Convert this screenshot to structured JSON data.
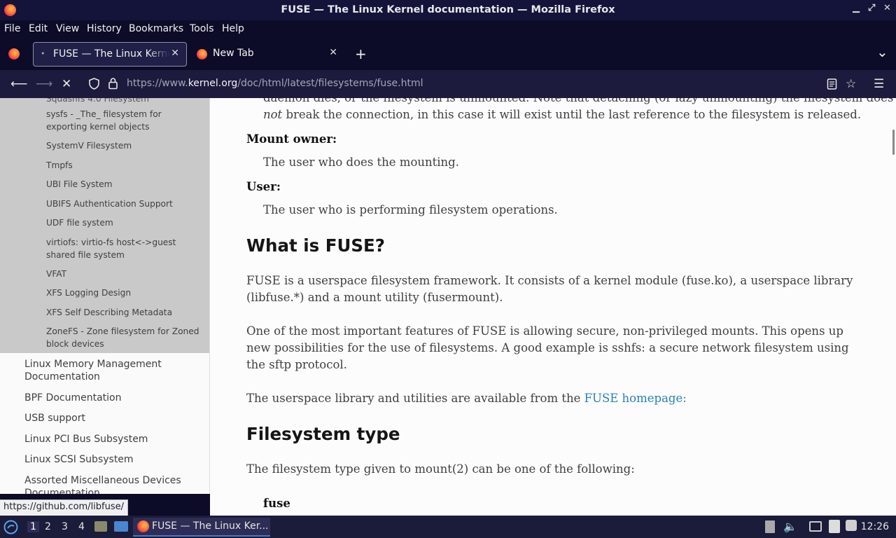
{
  "window": {
    "title": "FUSE — The Linux Kernel documentation — Mozilla Firefox",
    "min": "▁",
    "max": "⤢",
    "close": "✕"
  },
  "menu": [
    "File",
    "Edit",
    "View",
    "History",
    "Bookmarks",
    "Tools",
    "Help"
  ],
  "tabs": [
    {
      "label": "FUSE — The Linux Kernel documentation",
      "close": "✕"
    },
    {
      "label": "New Tab",
      "close": "✕"
    }
  ],
  "tabbar": {
    "new_tab": "+",
    "list": "⌄"
  },
  "nav": {
    "url_pre": "https://www.",
    "url_host": "kernel.org",
    "url_post": "/doc/html/latest/filesystems/fuse.html"
  },
  "sidebar": {
    "sub_items": [
      "sysfs - _The_ filesystem for exporting kernel objects",
      "SystemV Filesystem",
      "Tmpfs",
      "UBI File System",
      "UBIFS Authentication Support",
      "UDF file system",
      "virtiofs: virtio-fs host<->guest shared file system",
      "VFAT",
      "XFS Logging Design",
      "XFS Self Describing Metadata",
      "ZoneFS - Zone filesystem for Zoned block devices"
    ],
    "top_items": [
      "Linux Memory Management Documentation",
      "BPF Documentation",
      "USB support",
      "Linux PCI Bus Subsystem",
      "Linux SCSI Subsystem",
      "Assorted Miscellaneous Devices Documentation"
    ]
  },
  "content": {
    "frag1": "daemon dies, or the filesystem is unmounted. Note that detaching (or lazy unmounting) the filesystem does",
    "frag2_em": "not",
    "frag2": " break the connection, in this case it will exist until the last reference to the filesystem is released.",
    "dt1": "Mount owner:",
    "dd1": "The user who does the mounting.",
    "dt2": "User:",
    "dd2": "The user who is performing filesystem operations.",
    "h1": "What is FUSE?",
    "p1": "FUSE is a userspace filesystem framework. It consists of a kernel module (fuse.ko), a userspace library (libfuse.*) and a mount utility (fusermount).",
    "p2": "One of the most important features of FUSE is allowing secure, non-privileged mounts. This opens up new possibilities for the use of filesystems. A good example is sshfs: a secure network filesystem using the sftp protocol.",
    "p3": "The userspace library and utilities are available from the ",
    "p3_link": "FUSE homepage:",
    "h2": "Filesystem type",
    "p4": "The filesystem type given to mount(2) can be one of the following:",
    "dt3": "fuse"
  },
  "status_link": "https://github.com/libfuse/",
  "taskbar": {
    "workspaces": [
      "1",
      "2",
      "3",
      "4"
    ],
    "app": "FUSE — The Linux Ker...",
    "clock": "12:26"
  }
}
